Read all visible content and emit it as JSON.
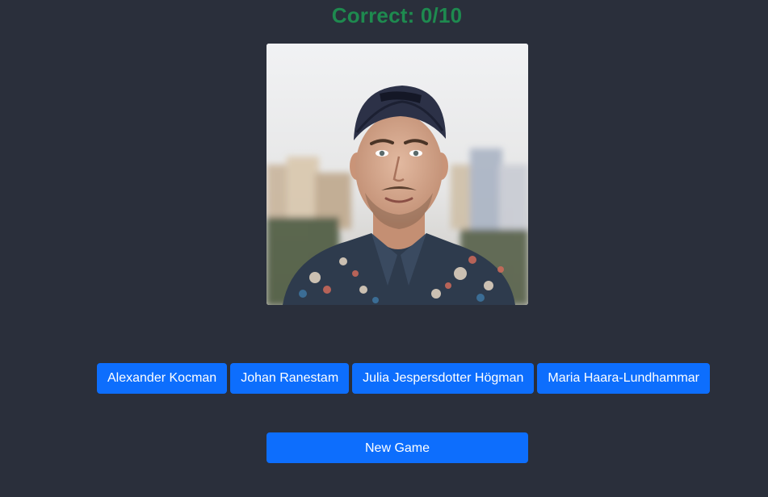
{
  "score": {
    "text": "Correct: 0/10",
    "color": "#1e8a4f"
  },
  "photo": {
    "subject": "portrait-photo"
  },
  "answers": [
    {
      "label": "Alexander Kocman"
    },
    {
      "label": "Johan Ranestam"
    },
    {
      "label": "Julia Jespersdotter Högman"
    },
    {
      "label": "Maria Haara-Lundhammar"
    }
  ],
  "new_game": {
    "label": "New Game"
  },
  "colors": {
    "background": "#2a2f3b",
    "button": "#0d6efd"
  }
}
